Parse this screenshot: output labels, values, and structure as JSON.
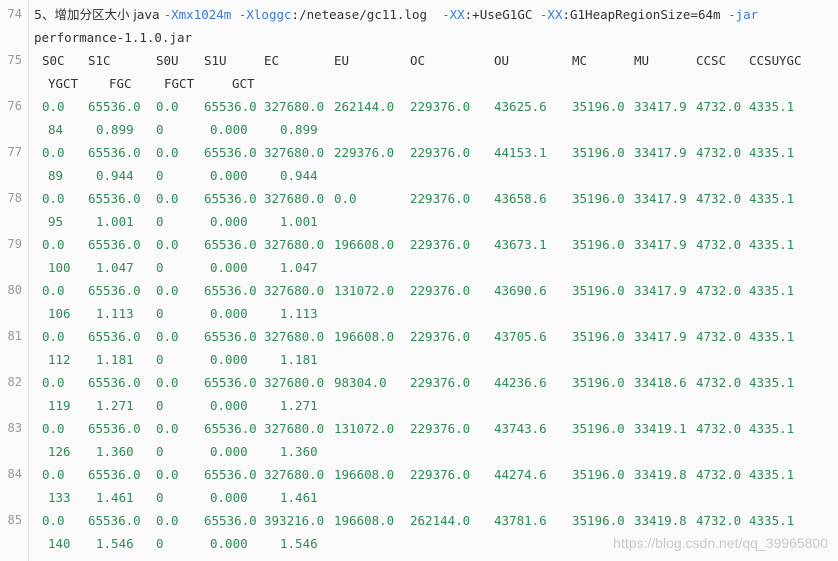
{
  "command": {
    "line_number": "74",
    "segments": [
      {
        "text": "5、增加分区大小 java ",
        "kind": "text"
      },
      {
        "text": "-Xmx1024m",
        "kind": "flag"
      },
      {
        "text": " ",
        "kind": "text"
      },
      {
        "text": "-Xloggc",
        "kind": "flag"
      },
      {
        "text": ":/netease/gc11.log  ",
        "kind": "text"
      },
      {
        "text": "-XX",
        "kind": "flag"
      },
      {
        "text": ":+UseG1GC ",
        "kind": "text"
      },
      {
        "text": "-XX",
        "kind": "flag"
      },
      {
        "text": ":G1HeapRegionSize=64m ",
        "kind": "text"
      },
      {
        "text": "-jar",
        "kind": "flag"
      }
    ],
    "continuation": "performance-1.1.0.jar"
  },
  "header": {
    "line_number": "75",
    "row1": [
      "S0C",
      "S1C",
      "S0U",
      "S1U",
      "EC",
      "EU",
      "OC",
      "OU",
      "MC",
      "MU",
      "CCSC",
      "CCSU",
      "YGC"
    ],
    "row2": [
      "YGCT",
      "FGC",
      "FGCT",
      "GCT"
    ]
  },
  "rows": [
    {
      "line_number": "76",
      "main": [
        "0.0",
        "65536.0",
        "0.0",
        "65536.0",
        "327680.0",
        "262144.0",
        "229376.0",
        "43625.6",
        "35196.0",
        "33417.9",
        "4732.0",
        "4335.1"
      ],
      "wrap": [
        "84",
        "0.899",
        "0",
        "0.000",
        "0.899"
      ]
    },
    {
      "line_number": "77",
      "main": [
        "0.0",
        "65536.0",
        "0.0",
        "65536.0",
        "327680.0",
        "229376.0",
        "229376.0",
        "44153.1",
        "35196.0",
        "33417.9",
        "4732.0",
        "4335.1"
      ],
      "wrap": [
        "89",
        "0.944",
        "0",
        "0.000",
        "0.944"
      ]
    },
    {
      "line_number": "78",
      "main": [
        "0.0",
        "65536.0",
        "0.0",
        "65536.0",
        "327680.0",
        "0.0",
        "229376.0",
        "43658.6",
        "35196.0",
        "33417.9",
        "4732.0",
        "4335.1"
      ],
      "wrap": [
        "95",
        "1.001",
        "0",
        "0.000",
        "1.001"
      ]
    },
    {
      "line_number": "79",
      "main": [
        "0.0",
        "65536.0",
        "0.0",
        "65536.0",
        "327680.0",
        "196608.0",
        "229376.0",
        "43673.1",
        "35196.0",
        "33417.9",
        "4732.0",
        "4335.1"
      ],
      "wrap": [
        "100",
        "1.047",
        "0",
        "0.000",
        "1.047"
      ]
    },
    {
      "line_number": "80",
      "main": [
        "0.0",
        "65536.0",
        "0.0",
        "65536.0",
        "327680.0",
        "131072.0",
        "229376.0",
        "43690.6",
        "35196.0",
        "33417.9",
        "4732.0",
        "4335.1"
      ],
      "wrap": [
        "106",
        "1.113",
        "0",
        "0.000",
        "1.113"
      ]
    },
    {
      "line_number": "81",
      "main": [
        "0.0",
        "65536.0",
        "0.0",
        "65536.0",
        "327680.0",
        "196608.0",
        "229376.0",
        "43705.6",
        "35196.0",
        "33417.9",
        "4732.0",
        "4335.1"
      ],
      "wrap": [
        "112",
        "1.181",
        "0",
        "0.000",
        "1.181"
      ]
    },
    {
      "line_number": "82",
      "main": [
        "0.0",
        "65536.0",
        "0.0",
        "65536.0",
        "327680.0",
        "98304.0",
        "229376.0",
        "44236.6",
        "35196.0",
        "33418.6",
        "4732.0",
        "4335.1"
      ],
      "wrap": [
        "119",
        "1.271",
        "0",
        "0.000",
        "1.271"
      ]
    },
    {
      "line_number": "83",
      "main": [
        "0.0",
        "65536.0",
        "0.0",
        "65536.0",
        "327680.0",
        "131072.0",
        "229376.0",
        "43743.6",
        "35196.0",
        "33419.1",
        "4732.0",
        "4335.1"
      ],
      "wrap": [
        "126",
        "1.360",
        "0",
        "0.000",
        "1.360"
      ]
    },
    {
      "line_number": "84",
      "main": [
        "0.0",
        "65536.0",
        "0.0",
        "65536.0",
        "327680.0",
        "196608.0",
        "229376.0",
        "44274.6",
        "35196.0",
        "33419.8",
        "4732.0",
        "4335.1"
      ],
      "wrap": [
        "133",
        "1.461",
        "0",
        "0.000",
        "1.461"
      ]
    },
    {
      "line_number": "85",
      "main": [
        "0.0",
        "65536.0",
        "0.0",
        "65536.0",
        "393216.0",
        "196608.0",
        "262144.0",
        "43781.6",
        "35196.0",
        "33419.8",
        "4732.0",
        "4335.1"
      ],
      "wrap": [
        "140",
        "1.546",
        "0",
        "0.000",
        "1.546"
      ]
    }
  ],
  "watermark": "https://blog.csdn.net/qq_39965800"
}
